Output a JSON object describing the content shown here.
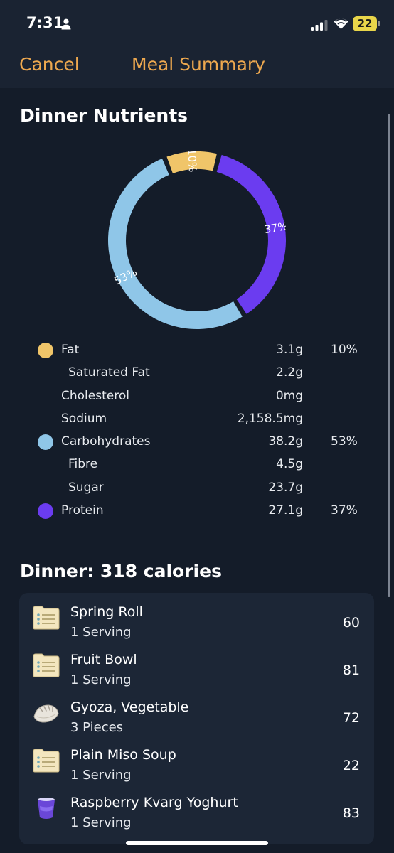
{
  "status": {
    "time": "7:31",
    "battery": "22"
  },
  "nav": {
    "cancel": "Cancel",
    "title": "Meal Summary"
  },
  "nutrients_title": "Dinner Nutrients",
  "chart_data": {
    "type": "pie",
    "categories": [
      "Fat",
      "Protein",
      "Carbohydrates"
    ],
    "values": [
      10,
      37,
      53
    ],
    "labels": [
      "10%",
      "37%",
      "53%"
    ],
    "colors": [
      "#f0c569",
      "#6b3cf0",
      "#8fc6e8"
    ]
  },
  "nutrients": [
    {
      "name": "Fat",
      "amount": "3.1g",
      "pct": "10%",
      "color": "#f0c569",
      "dot": true
    },
    {
      "name": "Saturated Fat",
      "amount": "2.2g",
      "pct": "",
      "sub": true
    },
    {
      "name": "Cholesterol",
      "amount": "0mg",
      "pct": ""
    },
    {
      "name": "Sodium",
      "amount": "2,158.5mg",
      "pct": ""
    },
    {
      "name": "Carbohydrates",
      "amount": "38.2g",
      "pct": "53%",
      "color": "#8fc6e8",
      "dot": true
    },
    {
      "name": "Fibre",
      "amount": "4.5g",
      "pct": "",
      "sub": true
    },
    {
      "name": "Sugar",
      "amount": "23.7g",
      "pct": "",
      "sub": true
    },
    {
      "name": "Protein",
      "amount": "27.1g",
      "pct": "37%",
      "color": "#6b3cf0",
      "dot": true
    }
  ],
  "dinner_title": "Dinner: 318 calories",
  "foods": [
    {
      "name": "Spring Roll",
      "serving": "1 Serving",
      "calories": "60",
      "icon": "list-icon"
    },
    {
      "name": "Fruit Bowl",
      "serving": "1 Serving",
      "calories": "81",
      "icon": "list-icon"
    },
    {
      "name": "Gyoza, Vegetable",
      "serving": "3 Pieces",
      "calories": "72",
      "icon": "dumpling-icon"
    },
    {
      "name": "Plain Miso Soup",
      "serving": "1 Serving",
      "calories": "22",
      "icon": "list-icon"
    },
    {
      "name": "Raspberry Kvarg Yoghurt",
      "serving": "1 Serving",
      "calories": "83",
      "icon": "yoghurt-cup-icon"
    }
  ]
}
